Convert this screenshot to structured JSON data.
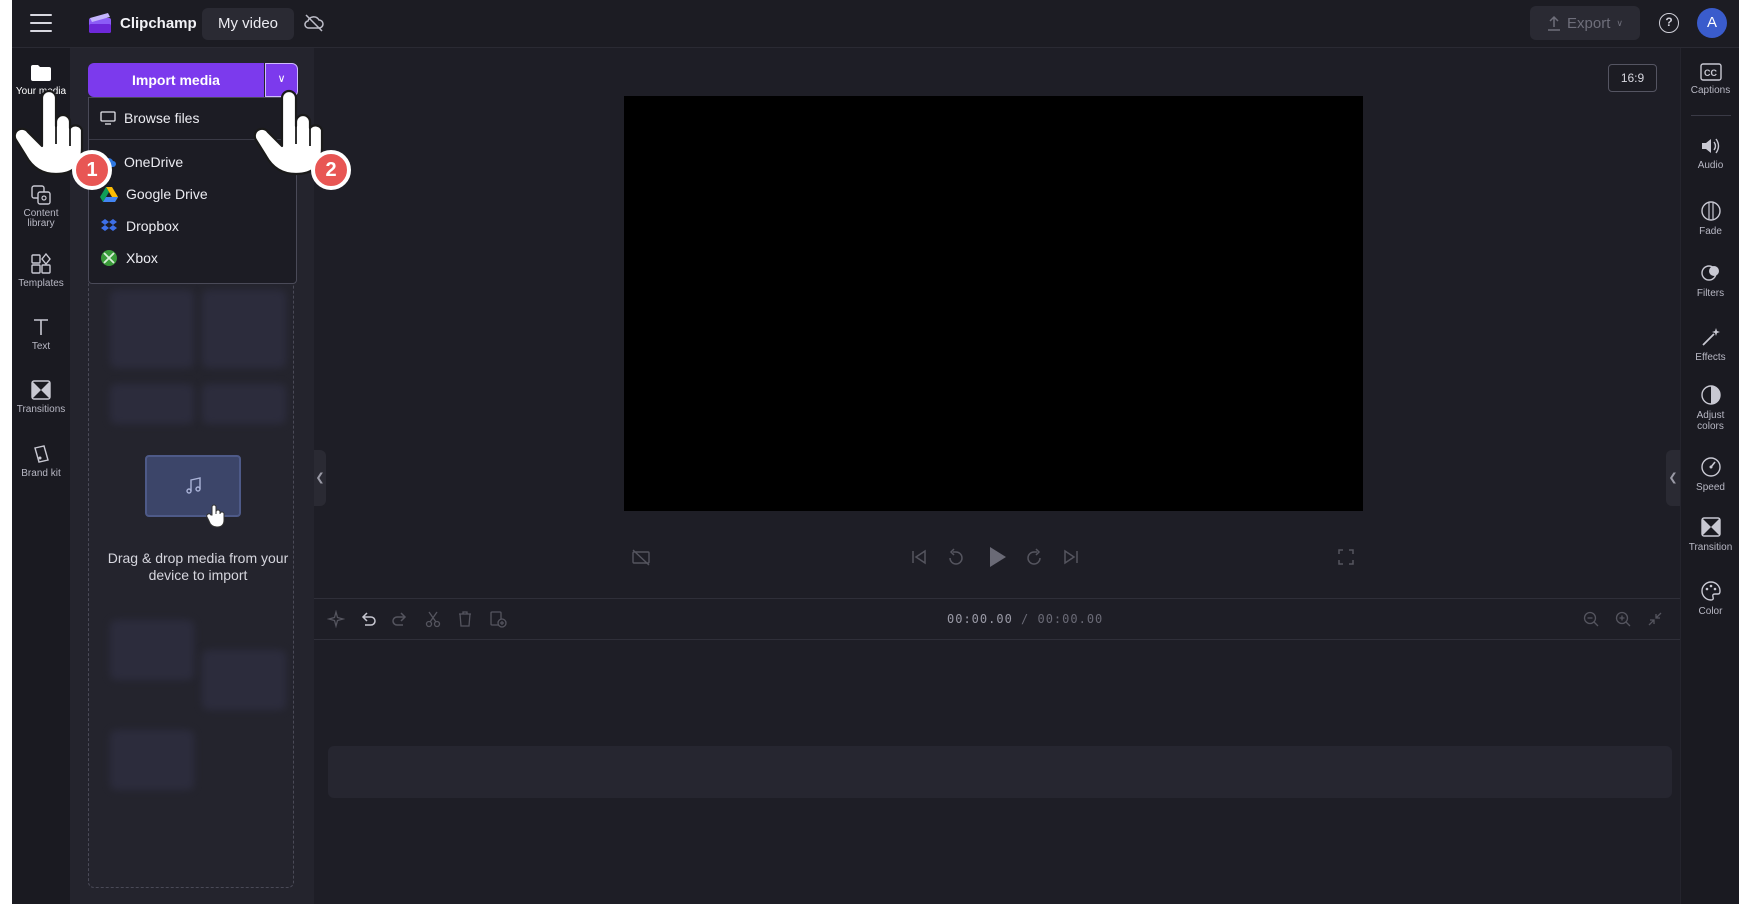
{
  "topbar": {
    "brand": "Clipchamp",
    "project_name": "My video",
    "export_label": "Export",
    "help_label": "?",
    "avatar_initial": "A"
  },
  "left_rail": {
    "items": [
      {
        "label": "Your media",
        "icon": "folder-icon"
      },
      {
        "label": "Content library",
        "icon": "content-library-icon"
      },
      {
        "label": "Templates",
        "icon": "templates-icon"
      },
      {
        "label": "Text",
        "icon": "text-icon"
      },
      {
        "label": "Transitions",
        "icon": "transitions-icon"
      },
      {
        "label": "Brand kit",
        "icon": "brand-kit-icon"
      }
    ]
  },
  "media_panel": {
    "import_label": "Import media",
    "dropdown": [
      {
        "label": "Browse files",
        "icon": "monitor-icon"
      },
      {
        "label": "OneDrive",
        "icon": "onedrive-icon"
      },
      {
        "label": "Google Drive",
        "icon": "google-drive-icon"
      },
      {
        "label": "Dropbox",
        "icon": "dropbox-icon"
      },
      {
        "label": "Xbox",
        "icon": "xbox-icon"
      }
    ],
    "drop_text": "Drag & drop media from your device to import"
  },
  "preview": {
    "aspect_ratio": "16:9"
  },
  "timeline": {
    "current_time": "00:00.00",
    "separator": " / ",
    "total_time": "00:00.00"
  },
  "right_rail": {
    "items": [
      {
        "label": "Captions",
        "icon": "captions-icon"
      },
      {
        "label": "Audio",
        "icon": "audio-icon"
      },
      {
        "label": "Fade",
        "icon": "fade-icon"
      },
      {
        "label": "Filters",
        "icon": "filters-icon"
      },
      {
        "label": "Effects",
        "icon": "effects-icon"
      },
      {
        "label": "Adjust colors",
        "icon": "adjust-colors-icon"
      },
      {
        "label": "Speed",
        "icon": "speed-icon"
      },
      {
        "label": "Transition",
        "icon": "transition-icon"
      },
      {
        "label": "Color",
        "icon": "color-icon"
      }
    ]
  },
  "callouts": [
    {
      "step": "1"
    },
    {
      "step": "2"
    }
  ],
  "colors": {
    "accent": "#7c3aed",
    "background": "#1e1e26",
    "badge": "#e85654"
  }
}
